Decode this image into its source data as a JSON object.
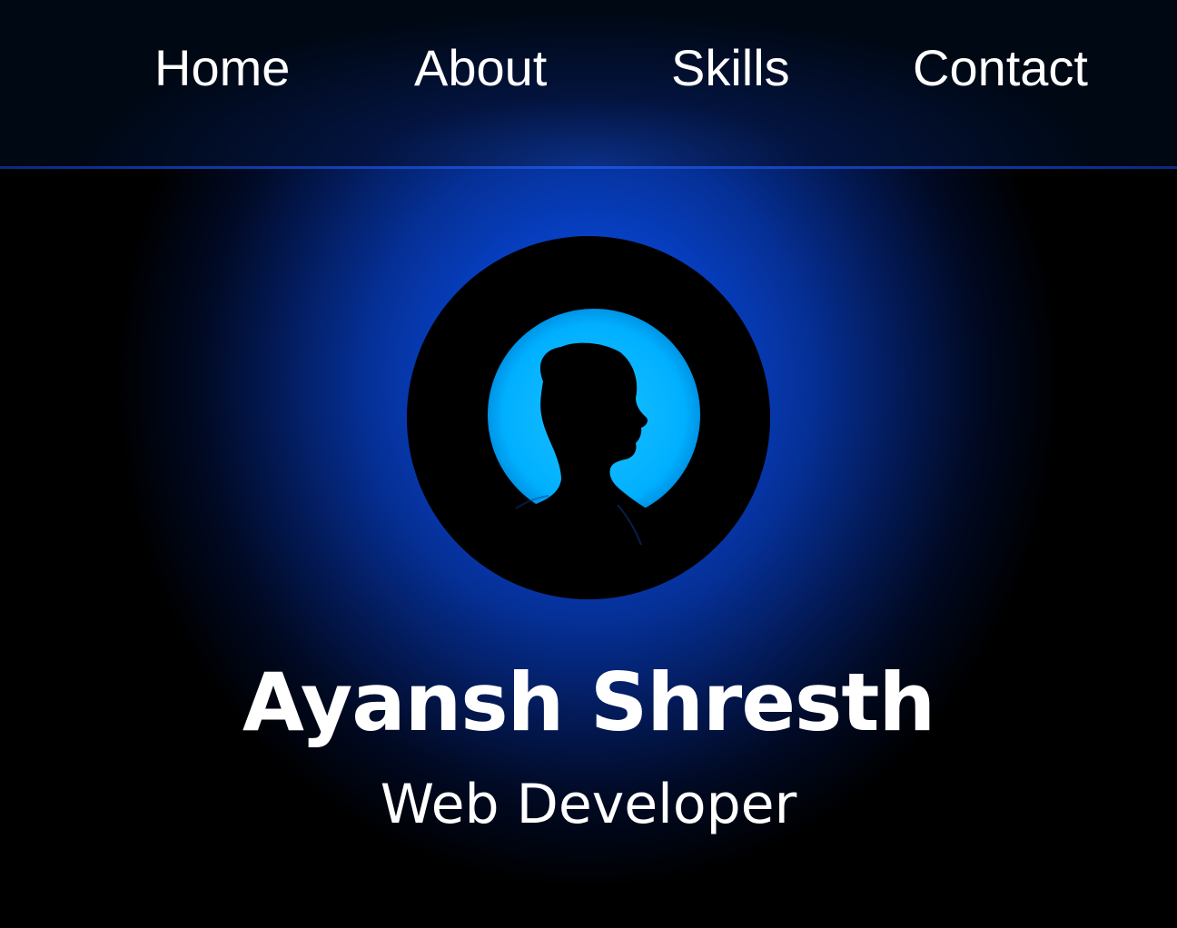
{
  "nav": {
    "items": [
      {
        "label": "Home"
      },
      {
        "label": "About"
      },
      {
        "label": "Skills"
      },
      {
        "label": "Contact"
      }
    ]
  },
  "profile": {
    "avatar_icon": "person-silhouette-icon",
    "name": "Ayansh Shresth",
    "role": "Web Developer"
  },
  "colors": {
    "background": "#000000",
    "glow": "#0a4fe0",
    "avatar_ring": "#000000",
    "avatar_light": "#00b0ff",
    "text": "#ffffff"
  }
}
